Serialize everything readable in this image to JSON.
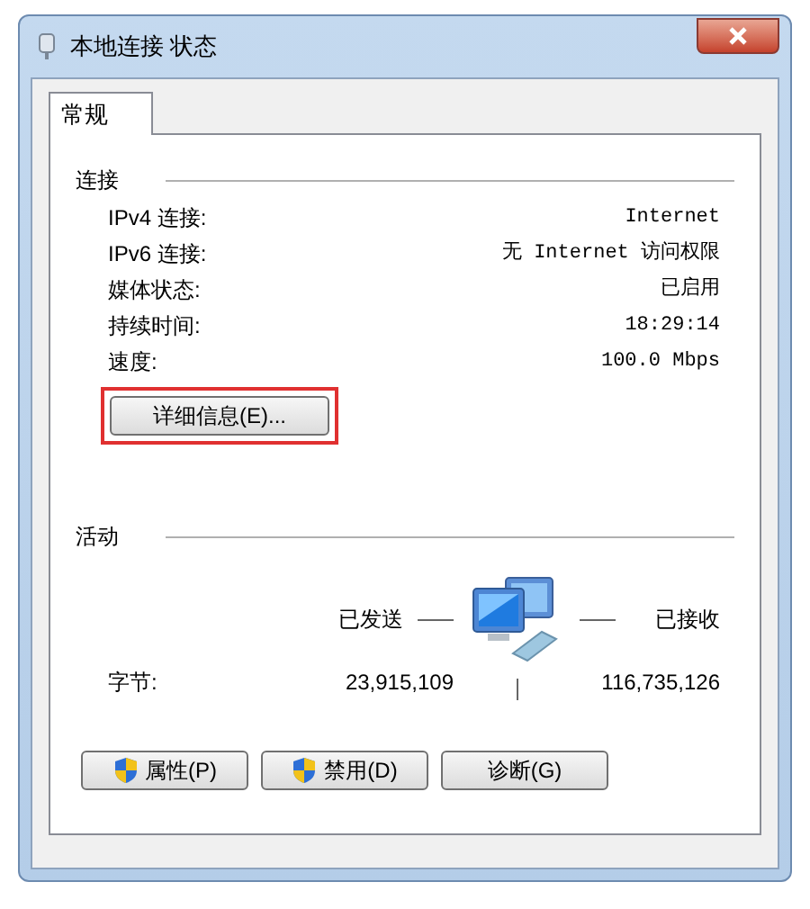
{
  "window": {
    "title": "本地连接 状态"
  },
  "tabs": [
    {
      "label": "常规",
      "selected": true
    }
  ],
  "connection": {
    "heading": "连接",
    "rows": [
      {
        "label": "IPv4 连接:",
        "value": "Internet"
      },
      {
        "label": "IPv6 连接:",
        "value": "无 Internet 访问权限"
      },
      {
        "label": "媒体状态:",
        "value": "已启用"
      },
      {
        "label": "持续时间:",
        "value": "18:29:14"
      },
      {
        "label": "速度:",
        "value": "100.0 Mbps"
      }
    ]
  },
  "details_button": {
    "label": "详细信息(E)...",
    "highlighted": true
  },
  "activity": {
    "heading": "活动",
    "sent_label": "已发送",
    "received_label": "已接收",
    "bytes_label": "字节:",
    "sent": "23,915,109",
    "received": "116,735,126"
  },
  "buttons": [
    {
      "label": "属性(P)",
      "shield": true
    },
    {
      "label": "禁用(D)",
      "shield": true
    },
    {
      "label": "诊断(G)",
      "shield": false
    }
  ]
}
